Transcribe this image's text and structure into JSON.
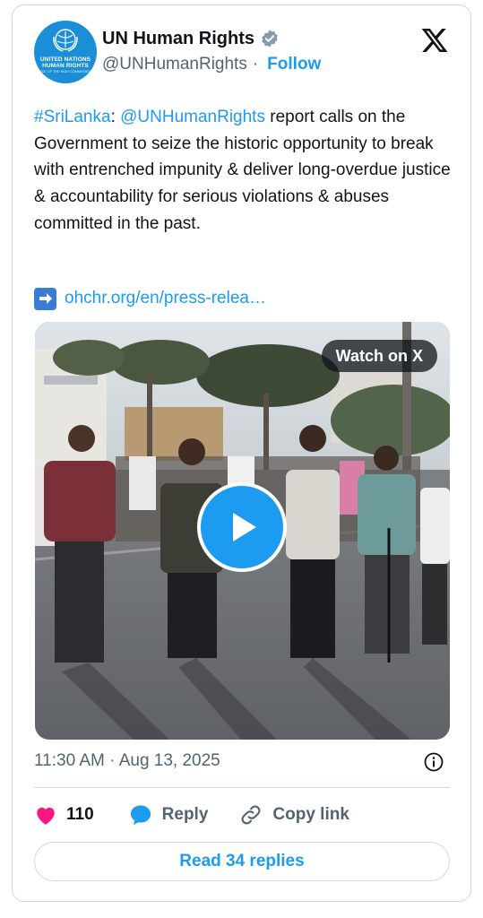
{
  "author": {
    "name": "UN Human Rights",
    "handle": "@UNHumanRights",
    "separator": "·",
    "follow_label": "Follow",
    "avatar_text": [
      "UNITED NATIONS",
      "HUMAN RIGHTS",
      "OFFICE OF THE HIGH COMMISSIONER"
    ]
  },
  "tweet": {
    "hashtag": "#SriLanka",
    "colon": ":",
    "mention": "@UNHumanRights",
    "text": " report calls on the Government to seize the historic opportunity to break with entrenched impunity & deliver long-overdue justice & accountability for serious violations & abuses committed in the past.",
    "url": "ohchr.org/en/press-relea…"
  },
  "media": {
    "watch_label": "Watch on X"
  },
  "meta": {
    "timestamp": "11:30 AM · Aug 13, 2025"
  },
  "actions": {
    "like_count": "110",
    "reply_label": "Reply",
    "copy_label": "Copy link",
    "read_replies_label": "Read 34 replies"
  },
  "colors": {
    "accent": "#1d9bf0",
    "heart": "#f91880",
    "text": "#0f1419",
    "muted": "#536471"
  }
}
